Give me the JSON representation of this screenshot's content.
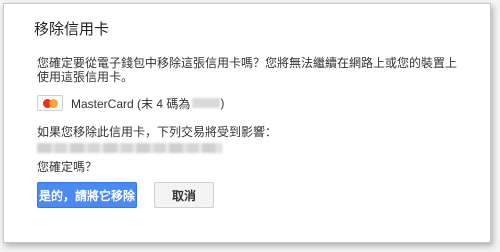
{
  "dialog": {
    "title": "移除信用卡",
    "description": "您確定要從電子錢包中移除這張信用卡嗎？您將無法繼續在網路上或您的裝置上使用這張信用卡。",
    "card": {
      "logo_icon": "mastercard-logo-icon",
      "label": "MasterCard (末 4 碼為",
      "label_close": ")"
    },
    "affect_text": "如果您移除此信用卡，下列交易將受到影響：",
    "confirm_text": "您確定嗎？",
    "buttons": {
      "confirm_label": "是的，請將它移除",
      "cancel_label": "取消"
    },
    "colors": {
      "primary_button": "#4a8af4",
      "secondary_button": "#f3f3f3"
    }
  }
}
